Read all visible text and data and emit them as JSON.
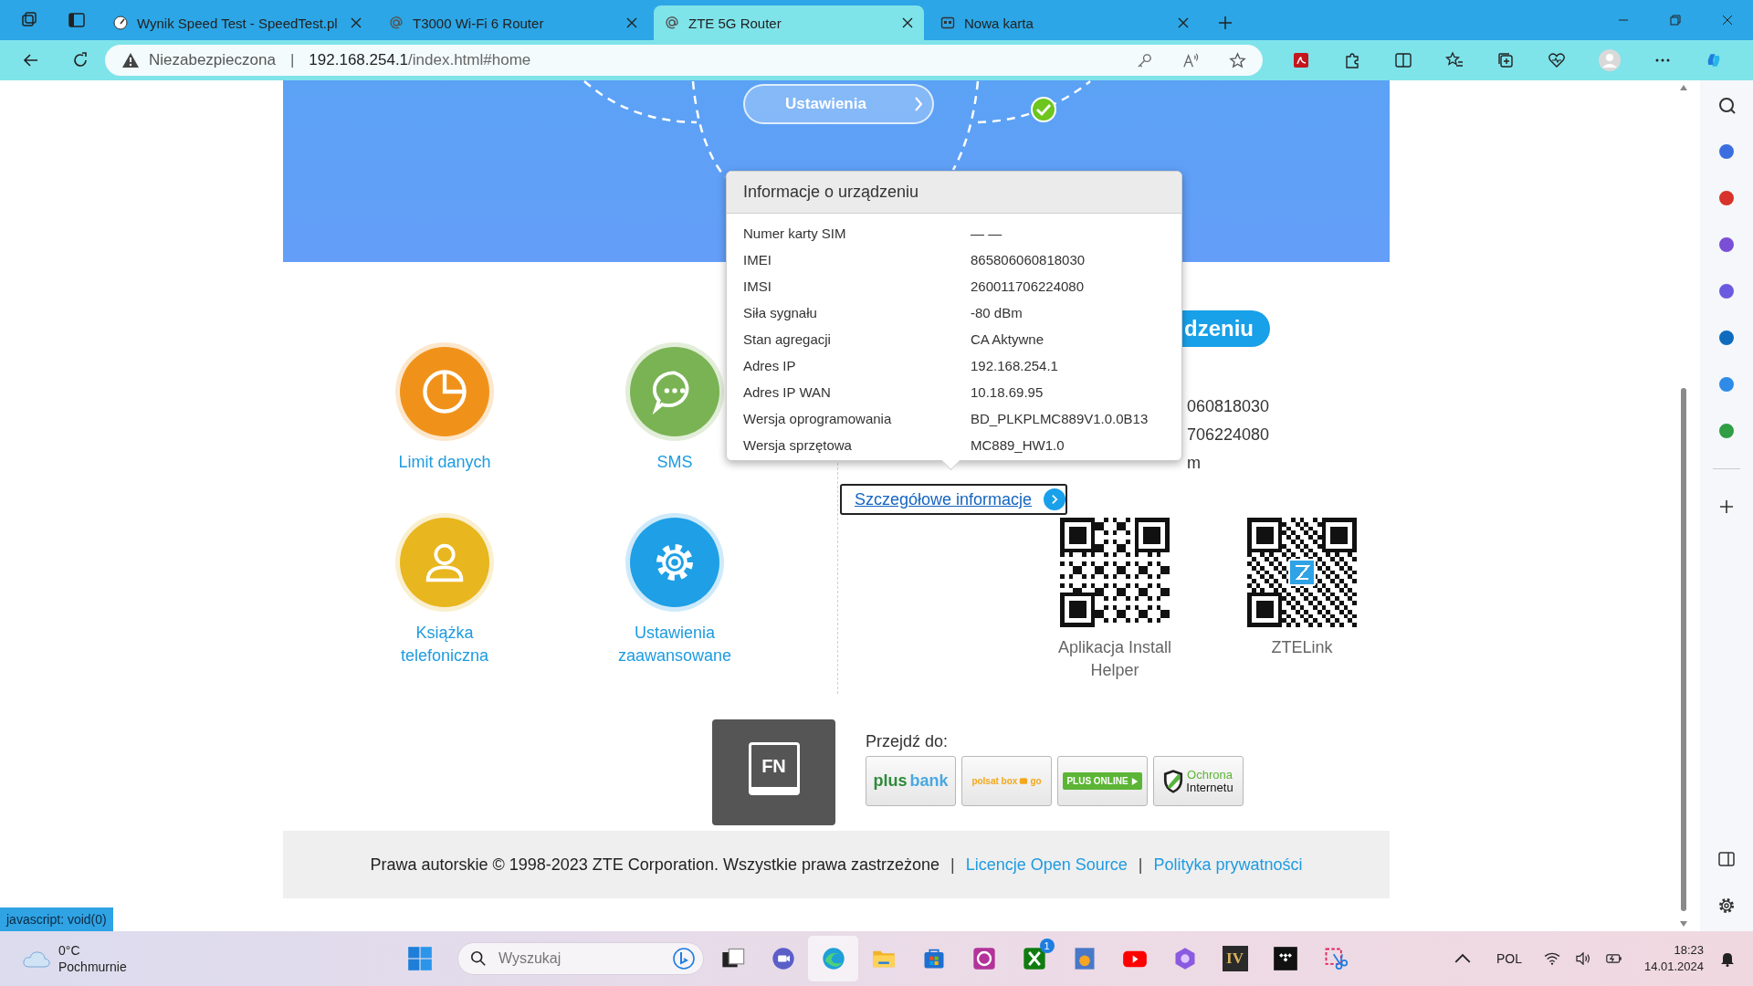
{
  "browser": {
    "tabs": [
      {
        "title": "Wynik Speed Test - SpeedTest.pl",
        "kind": "gauge",
        "selected": false
      },
      {
        "title": "T3000 Wi-Fi 6 Router",
        "kind": "at",
        "selected": false
      },
      {
        "title": "ZTE 5G Router",
        "kind": "at",
        "selected": true
      },
      {
        "title": "Nowa karta",
        "kind": "blank",
        "selected": false
      }
    ],
    "address_bar": {
      "security": "Niezabezpieczona",
      "separator": "|",
      "host": "192.168.254.1",
      "path": "/index.html#home"
    }
  },
  "banner": {
    "button": "Ustawienia"
  },
  "tiles": [
    {
      "label": "Limit danych",
      "kind": "chart",
      "color": "#f0921a"
    },
    {
      "label": "SMS",
      "kind": "chat",
      "color": "#7ab354"
    },
    {
      "label": "Książka telefoniczna",
      "kind": "person",
      "color": "#e8b61e"
    },
    {
      "label": "Ustawienia zaawansowane",
      "kind": "gear",
      "color": "#1e9fe6"
    }
  ],
  "device_info": {
    "title": "Informacje o urządzeniu",
    "rows": [
      {
        "label": "Numer karty SIM",
        "value": "— —"
      },
      {
        "label": "IMEI",
        "value": "865806060818030"
      },
      {
        "label": "IMSI",
        "value": "260011706224080"
      },
      {
        "label": "Siła sygnału",
        "value": "-80 dBm"
      },
      {
        "label": "Stan agregacji",
        "value": "CA Aktywne"
      },
      {
        "label": "Adres IP",
        "value": "192.168.254.1"
      },
      {
        "label": "Adres IP WAN",
        "value": "10.18.69.95"
      },
      {
        "label": "Wersja oprogramowania",
        "value": "BD_PLKPLMC889V1.0.0B13"
      },
      {
        "label": "Wersja sprzętowa",
        "value": "MC889_HW1.0"
      }
    ]
  },
  "background_fragments": {
    "heading": "dzeniu",
    "lines": [
      "060818030",
      "706224080",
      "m"
    ]
  },
  "details_link": "Szczegółowe informacje",
  "apps": [
    {
      "label": "Aplikacja Install Helper",
      "kind": "plain"
    },
    {
      "label": "ZTELink",
      "kind": "logo"
    }
  ],
  "partners": {
    "title": "Przejdź do:",
    "links": [
      {
        "kind": "plusbank",
        "parts": [
          "plus",
          "bank"
        ]
      },
      {
        "kind": "polsat",
        "parts": [
          "polsat box",
          "go"
        ]
      },
      {
        "kind": "plusonline",
        "parts": [
          "PLUS ONLINE"
        ]
      },
      {
        "kind": "ochrona",
        "parts": [
          "Ochrona",
          "Internetu"
        ]
      }
    ]
  },
  "fn_overlay": {
    "key": "FN"
  },
  "footer": {
    "items": [
      {
        "kind": "text",
        "text": "Prawa autorskie © 1998-2023 ZTE Corporation. Wszystkie prawa zastrzeżone"
      },
      {
        "kind": "separator",
        "text": "|"
      },
      {
        "kind": "link",
        "text": "Licencje Open Source"
      },
      {
        "kind": "separator",
        "text": "|"
      },
      {
        "kind": "link",
        "text": "Polityka prywatności"
      }
    ]
  },
  "status_link": "javascript: void(0)",
  "taskbar": {
    "weather": {
      "temp": "0°C",
      "condition": "Pochmurnie"
    },
    "search_placeholder": "Wyszukaj",
    "badge": "1",
    "app_label": "IV",
    "language": "POL",
    "time": "18:23",
    "date": "14.01.2024"
  }
}
